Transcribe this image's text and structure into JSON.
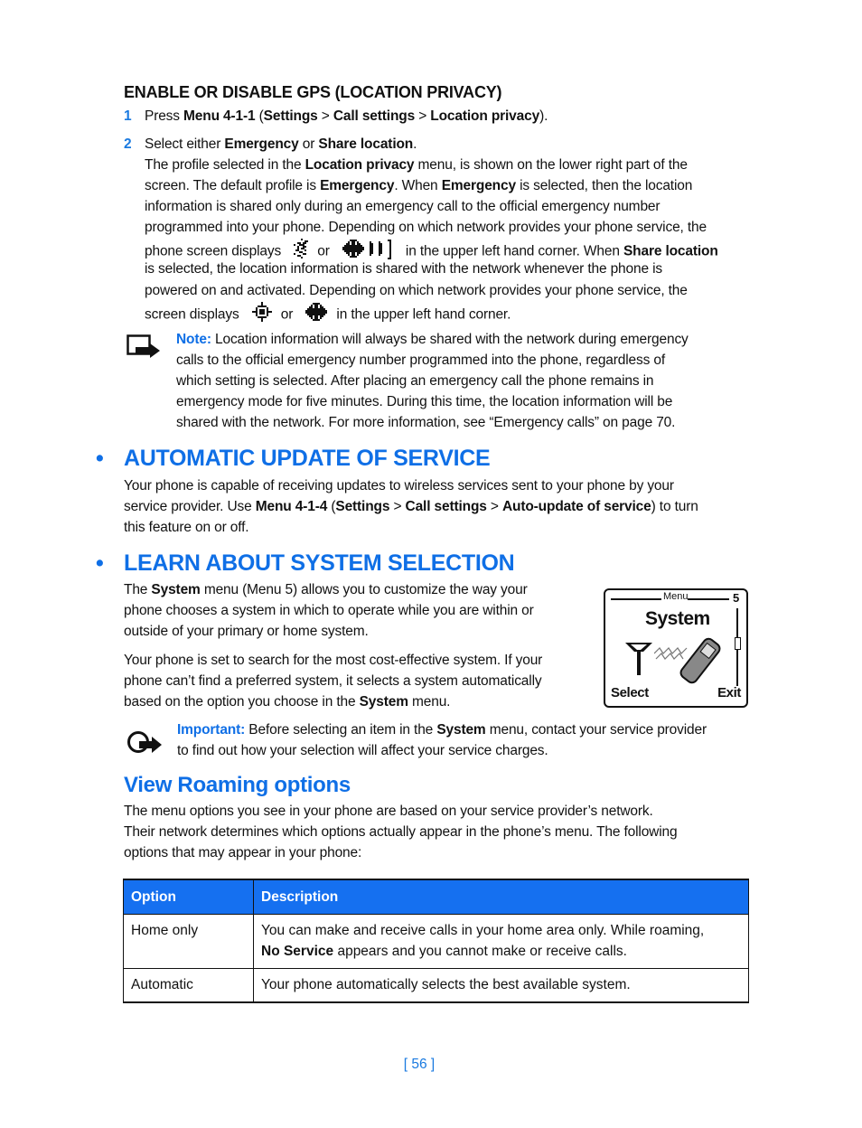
{
  "gps_section": {
    "heading": "ENABLE OR DISABLE GPS (LOCATION PRIVACY)",
    "step1": {
      "num": "1",
      "pre": "Press ",
      "menu": "Menu 4-1-1",
      "mid1": " (",
      "s1": "Settings",
      "gt1": " > ",
      "s2": "Call settings",
      "gt2": " > ",
      "s3": "Location privacy",
      "end": ")."
    },
    "step2": {
      "num": "2",
      "pre": "Select either ",
      "opt1": "Emergency",
      "or": " or ",
      "opt2": "Share location",
      "end": "."
    },
    "para": {
      "l1a": "The profile selected in the ",
      "l1b": "Location privacy",
      "l1c": " menu, is shown on the lower right part of the",
      "l2a": "screen. The default profile is ",
      "l2b": "Emergency",
      "l2c": ". When ",
      "l2d": "Emergency",
      "l2e": " is selected, then the location",
      "l3": "information is shared only during an emergency call to the official emergency number",
      "l4": "programmed into your phone. Depending on which network provides your phone service, the",
      "l5a": "phone screen displays",
      "l5or": "or",
      "l5b": "in the upper left hand corner. When ",
      "l5c": "Share location",
      "l6": "is selected, the location information is shared with the network whenever the phone is",
      "l7": "powered on and activated. Depending on which network provides your phone service, the",
      "l8a": "screen displays",
      "l8or": "or",
      "l8b": "in the upper left hand corner."
    },
    "icons": [
      "gps-emergency-icon-a",
      "gps-emergency-icon-b",
      "gps-share-icon-a",
      "gps-share-icon-b"
    ],
    "note": {
      "label": "Note:",
      "l1": " Location information will always be shared with the network during emergency",
      "l2": "calls to the official emergency number programmed into the phone, regardless of",
      "l3": "which setting is selected. After placing an emergency call the phone remains in",
      "l4": "emergency mode for five minutes. During this time, the location information will be",
      "l5": "shared with the network. For more information, see “Emergency calls” on page 70."
    }
  },
  "auto_update": {
    "bullet": "•",
    "heading": "AUTOMATIC UPDATE OF SERVICE",
    "l1": "Your phone is capable of receiving updates to wireless services sent to your phone by your",
    "l2a": "service provider. Use ",
    "l2b": "Menu 4-1-4",
    "l2c": " (",
    "l2d": "Settings",
    "l2e": " > ",
    "l2f": "Call settings",
    "l2g": " > ",
    "l2h": "Auto-update of service",
    "l2i": ") to turn",
    "l3": "this feature on or off."
  },
  "system_selection": {
    "bullet": "•",
    "heading": "LEARN ABOUT SYSTEM SELECTION",
    "p1": {
      "l1a": "The ",
      "l1b": "System",
      "l1c": " menu (Menu 5) allows you to customize the way your",
      "l2": "phone chooses a system in which to operate while you are within or",
      "l3": "outside of your primary or home system."
    },
    "p2": {
      "l1": "Your phone is set to search for the most cost-effective system. If your",
      "l2": "phone can’t find a preferred system, it selects a system automatically",
      "l3a": "based on the option you choose in the ",
      "l3b": "System",
      "l3c": " menu."
    },
    "phone_screen": {
      "header": "Menu",
      "number": "5",
      "title": "System",
      "left_soft": "Select",
      "right_soft": "Exit"
    },
    "important": {
      "label": "Important:",
      "l1a": " Before selecting an item in the ",
      "l1b": "System",
      "l1c": " menu, contact your service provider",
      "l2": "to find out how your selection will affect your service charges."
    }
  },
  "roaming": {
    "heading": "View Roaming options",
    "l1": "The menu options you see in your phone are based on your service provider’s network.",
    "l2": "Their network determines which options actually appear in the phone’s menu. The following",
    "l3": "options that may appear in your phone:",
    "table": {
      "headers": [
        "Option",
        "Description"
      ],
      "rows": [
        {
          "option": "Home only",
          "desc_l1": "You can make and receive calls in your home area only. While roaming,",
          "desc_l2b": "No Service",
          "desc_l2": " appears and you cannot make or receive calls."
        },
        {
          "option": "Automatic",
          "desc_l1": "Your phone automatically selects the best available system."
        }
      ]
    }
  },
  "footer": {
    "page": "[ 56 ]"
  },
  "colors": {
    "accent": "#0f6fe6",
    "table_header": "#1570f0"
  }
}
